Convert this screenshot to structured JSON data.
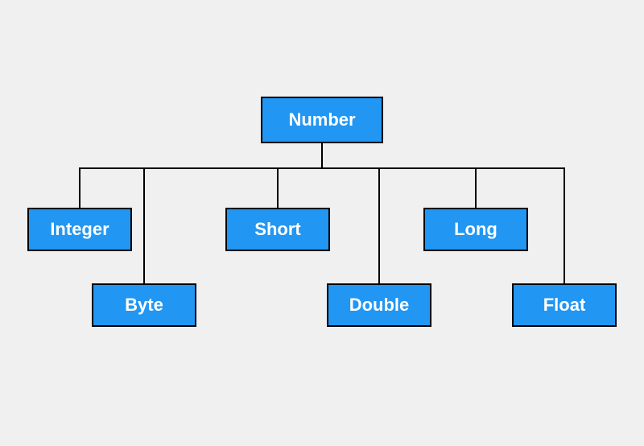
{
  "diagram": {
    "root": {
      "label": "Number"
    },
    "children": [
      {
        "id": "integer",
        "label": "Integer"
      },
      {
        "id": "byte",
        "label": "Byte"
      },
      {
        "id": "short",
        "label": "Short"
      },
      {
        "id": "double",
        "label": "Double"
      },
      {
        "id": "long",
        "label": "Long"
      },
      {
        "id": "float",
        "label": "Float"
      }
    ]
  },
  "colors": {
    "node_fill": "#2196f3",
    "node_border": "#000000",
    "text": "#ffffff",
    "background": "#f0f0f0"
  }
}
